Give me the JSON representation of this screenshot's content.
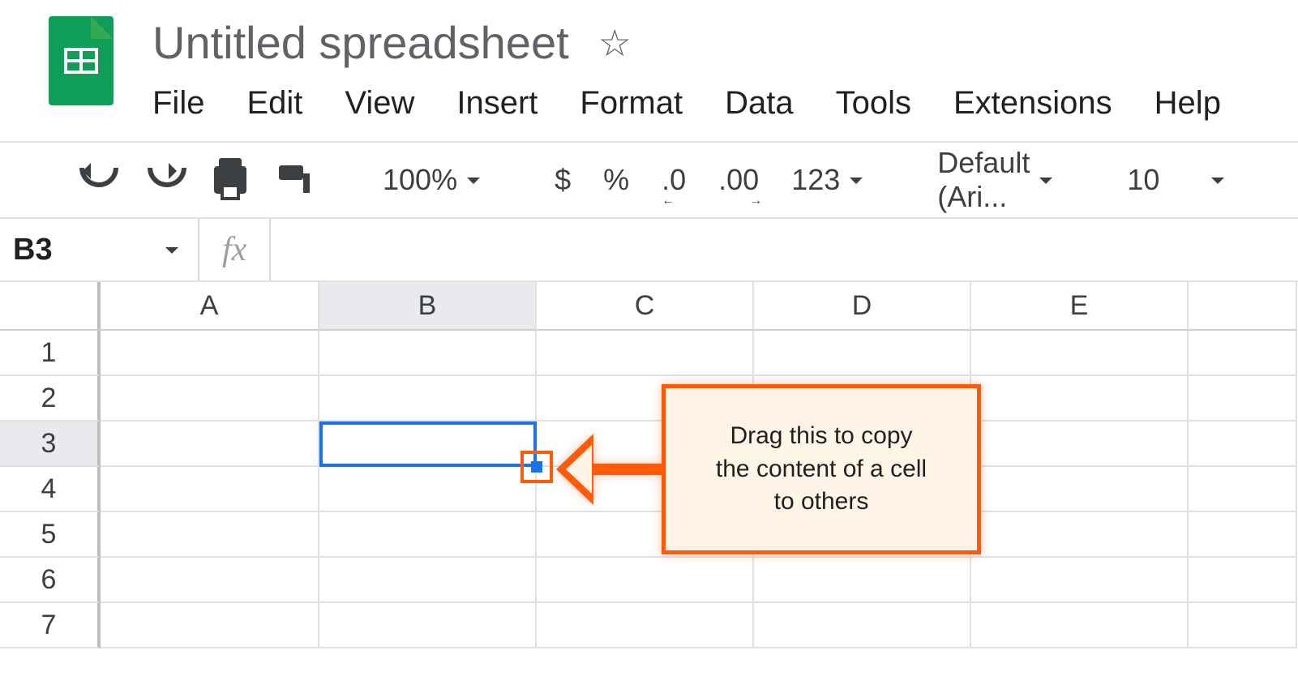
{
  "doc": {
    "title": "Untitled spreadsheet"
  },
  "menu": {
    "file": "File",
    "edit": "Edit",
    "view": "View",
    "insert": "Insert",
    "format": "Format",
    "data": "Data",
    "tools": "Tools",
    "extensions": "Extensions",
    "help": "Help"
  },
  "toolbar": {
    "zoom": "100%",
    "currency": "$",
    "percent": "%",
    "dec_decrease": ".0",
    "dec_increase": ".00",
    "format_num": "123",
    "font": "Default (Ari...",
    "font_size": "10"
  },
  "namebox": {
    "ref": "B3"
  },
  "columns": [
    "A",
    "B",
    "C",
    "D",
    "E"
  ],
  "rows": [
    "1",
    "2",
    "3",
    "4",
    "5",
    "6",
    "7"
  ],
  "selection": {
    "col": "B",
    "row": "3"
  },
  "callout": {
    "line1": "Drag this to copy",
    "line2": "the content of a cell",
    "line3": "to others"
  }
}
